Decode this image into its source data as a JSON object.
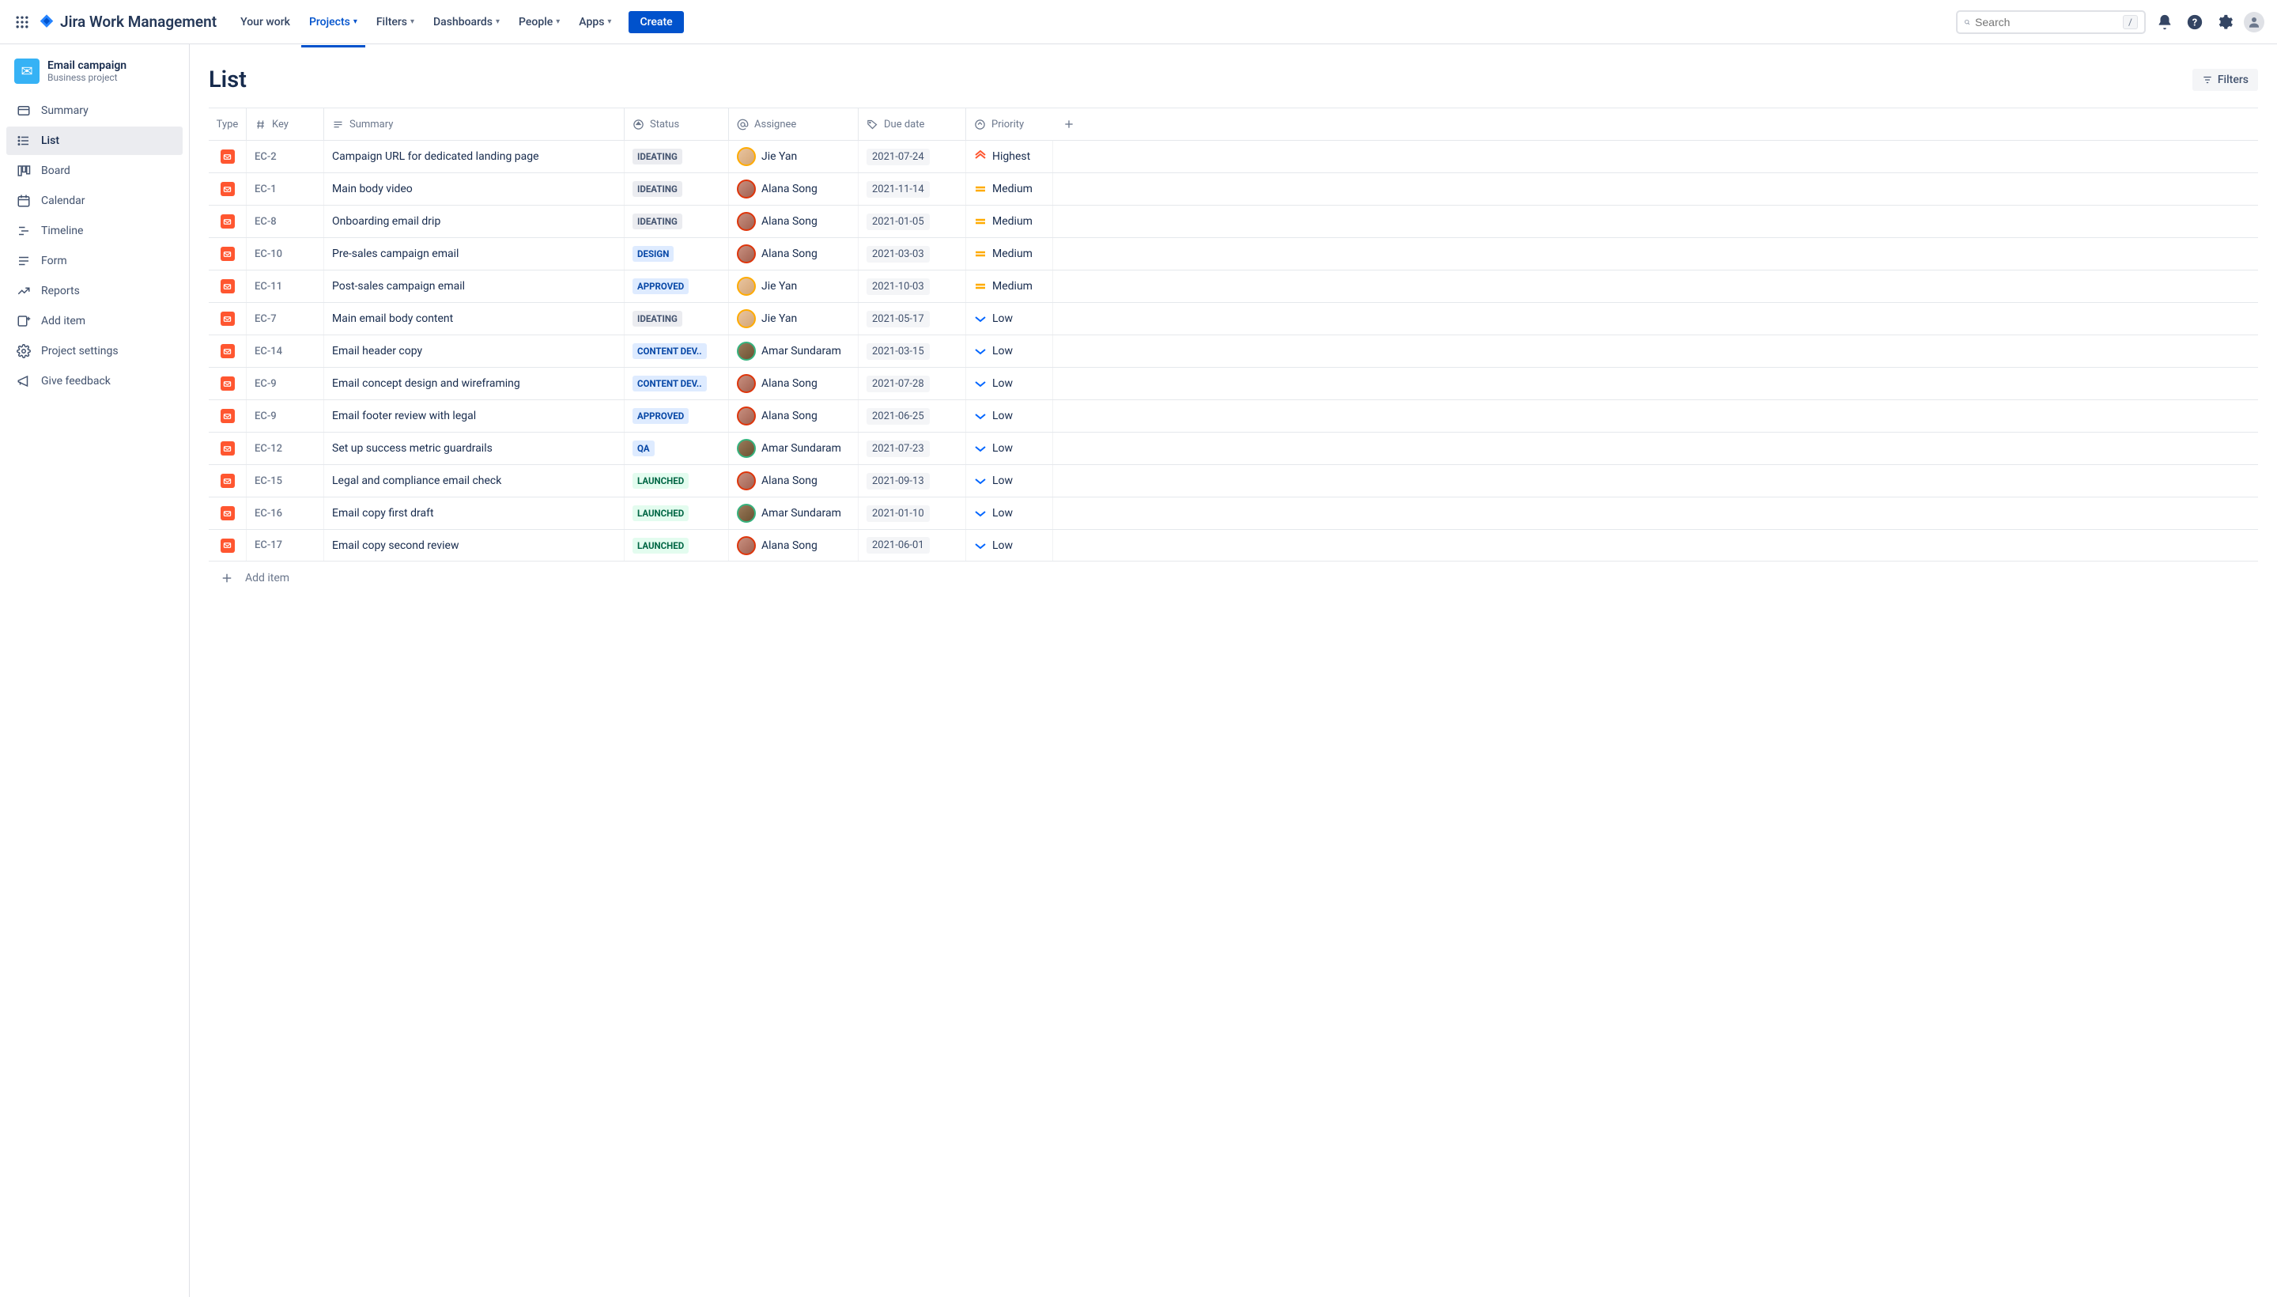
{
  "app_name": "Jira Work Management",
  "nav": {
    "your_work": "Your work",
    "projects": "Projects",
    "filters": "Filters",
    "dashboards": "Dashboards",
    "people": "People",
    "apps": "Apps",
    "create": "Create"
  },
  "search": {
    "placeholder": "Search",
    "slash": "/"
  },
  "project": {
    "name": "Email campaign",
    "subtitle": "Business project"
  },
  "sidebar": {
    "summary": "Summary",
    "list": "List",
    "board": "Board",
    "calendar": "Calendar",
    "timeline": "Timeline",
    "form": "Form",
    "reports": "Reports",
    "add_item": "Add item",
    "settings": "Project settings",
    "feedback": "Give feedback"
  },
  "page": {
    "title": "List",
    "filters": "Filters",
    "add_item": "Add item"
  },
  "columns": {
    "type": "Type",
    "key": "Key",
    "summary": "Summary",
    "status": "Status",
    "assignee": "Assignee",
    "due": "Due date",
    "priority": "Priority"
  },
  "rows": [
    {
      "key": "EC-2",
      "summary": "Campaign URL for dedicated landing page",
      "status": "IDEATING",
      "status_c": "grey",
      "assignee": "Jie Yan",
      "av": "jie",
      "due": "2021-07-24",
      "priority": "Highest",
      "pri": "highest"
    },
    {
      "key": "EC-1",
      "summary": "Main body video",
      "status": "IDEATING",
      "status_c": "grey",
      "assignee": "Alana Song",
      "av": "alana",
      "due": "2021-11-14",
      "priority": "Medium",
      "pri": "medium"
    },
    {
      "key": "EC-8",
      "summary": "Onboarding email drip",
      "status": "IDEATING",
      "status_c": "grey",
      "assignee": "Alana Song",
      "av": "alana",
      "due": "2021-01-05",
      "priority": "Medium",
      "pri": "medium"
    },
    {
      "key": "EC-10",
      "summary": "Pre-sales campaign email",
      "status": "DESIGN",
      "status_c": "blue",
      "assignee": "Alana Song",
      "av": "alana",
      "due": "2021-03-03",
      "priority": "Medium",
      "pri": "medium"
    },
    {
      "key": "EC-11",
      "summary": "Post-sales campaign email",
      "status": "APPROVED",
      "status_c": "blue",
      "assignee": "Jie Yan",
      "av": "jie",
      "due": "2021-10-03",
      "priority": "Medium",
      "pri": "medium"
    },
    {
      "key": "EC-7",
      "summary": "Main email body content",
      "status": "IDEATING",
      "status_c": "grey",
      "assignee": "Jie Yan",
      "av": "jie",
      "due": "2021-05-17",
      "priority": "Low",
      "pri": "low"
    },
    {
      "key": "EC-14",
      "summary": "Email header copy",
      "status": "CONTENT DEV..",
      "status_c": "blue",
      "assignee": "Amar Sundaram",
      "av": "amar",
      "due": "2021-03-15",
      "priority": "Low",
      "pri": "low"
    },
    {
      "key": "EC-9",
      "summary": "Email concept design and wireframing",
      "status": "CONTENT DEV..",
      "status_c": "blue",
      "assignee": "Alana Song",
      "av": "alana",
      "due": "2021-07-28",
      "priority": "Low",
      "pri": "low"
    },
    {
      "key": "EC-9",
      "summary": "Email footer review with legal",
      "status": "APPROVED",
      "status_c": "blue",
      "assignee": "Alana Song",
      "av": "alana",
      "due": "2021-06-25",
      "priority": "Low",
      "pri": "low"
    },
    {
      "key": "EC-12",
      "summary": "Set up success metric guardrails",
      "status": "QA",
      "status_c": "blue",
      "assignee": "Amar Sundaram",
      "av": "amar",
      "due": "2021-07-23",
      "priority": "Low",
      "pri": "low"
    },
    {
      "key": "EC-15",
      "summary": "Legal and compliance email check",
      "status": "LAUNCHED",
      "status_c": "green",
      "assignee": "Alana Song",
      "av": "alana",
      "due": "2021-09-13",
      "priority": "Low",
      "pri": "low"
    },
    {
      "key": "EC-16",
      "summary": "Email copy first draft",
      "status": "LAUNCHED",
      "status_c": "green",
      "assignee": "Amar Sundaram",
      "av": "amar",
      "due": "2021-01-10",
      "priority": "Low",
      "pri": "low"
    },
    {
      "key": "EC-17",
      "summary": "Email copy second review",
      "status": "LAUNCHED",
      "status_c": "green",
      "assignee": "Alana Song",
      "av": "alana",
      "due": "2021-06-01",
      "priority": "Low",
      "pri": "low"
    }
  ]
}
